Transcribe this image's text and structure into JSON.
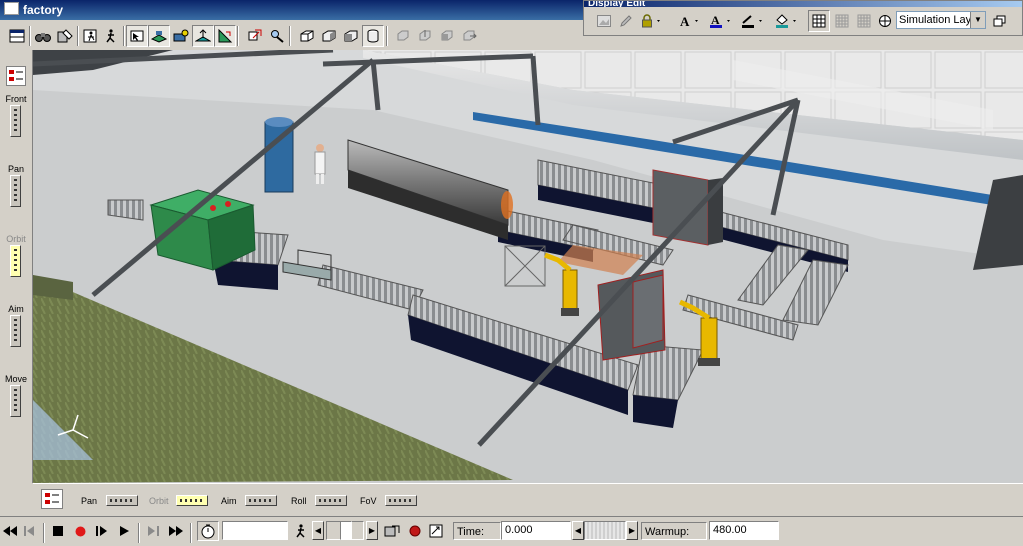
{
  "window": {
    "title": "factory"
  },
  "display_edit": {
    "title": "Display Edit",
    "layer_select": {
      "value": "Simulation Laye"
    }
  },
  "left_nav": {
    "items": [
      {
        "label": "Front",
        "active": false
      },
      {
        "label": "Pan",
        "active": false
      },
      {
        "label": "Orbit",
        "active": true
      },
      {
        "label": "Aim",
        "active": false
      },
      {
        "label": "Move",
        "active": false
      }
    ]
  },
  "bottom_nav": {
    "items": [
      {
        "label": "Pan",
        "active": false
      },
      {
        "label": "Orbit",
        "active": true
      },
      {
        "label": "Aim",
        "active": false
      },
      {
        "label": "Roll",
        "active": false
      },
      {
        "label": "FoV",
        "active": false
      }
    ]
  },
  "playback": {
    "time_label": "Time:",
    "time_value": "0.000",
    "warmup_label": "Warmup:",
    "warmup_value": "480.00"
  },
  "colors": {
    "titlebar": "#0a246a",
    "floor": "#c9cbcc",
    "wall_stripe": "#2a6aa8",
    "machine_green": "#2e8a4a",
    "robot_yellow": "#e8b800",
    "truss": "#4a4e52",
    "hedge": "#6f7a4a"
  },
  "icons": {
    "toolbar": [
      "layout-icon",
      "binoculars-icon",
      "model-edit-icon",
      "run-icon",
      "walker-icon",
      "object-select-icon",
      "floor-view-icon",
      "camera-icon",
      "elevation-icon",
      "plane-icon",
      "plan-view-icon",
      "zoom-icon",
      "box-left-icon",
      "box-right-icon",
      "box-back-icon",
      "box-front-icon",
      "object-front-icon",
      "object-top-icon",
      "object-side-icon",
      "object-move-icon"
    ],
    "display_edit": [
      "image-icon",
      "pencil-icon",
      "lock-icon",
      "font-icon",
      "font-color-icon",
      "line-color-icon",
      "fill-color-icon",
      "grid-snap-icon",
      "grid-icon",
      "center-icon",
      "restore-window-icon"
    ],
    "playback": [
      "rewind-icon",
      "step-back-icon",
      "stop-icon",
      "record-icon",
      "step-icon",
      "play-icon",
      "step-forward-icon",
      "fast-forward-icon",
      "stopwatch-icon",
      "walker-icon"
    ]
  }
}
